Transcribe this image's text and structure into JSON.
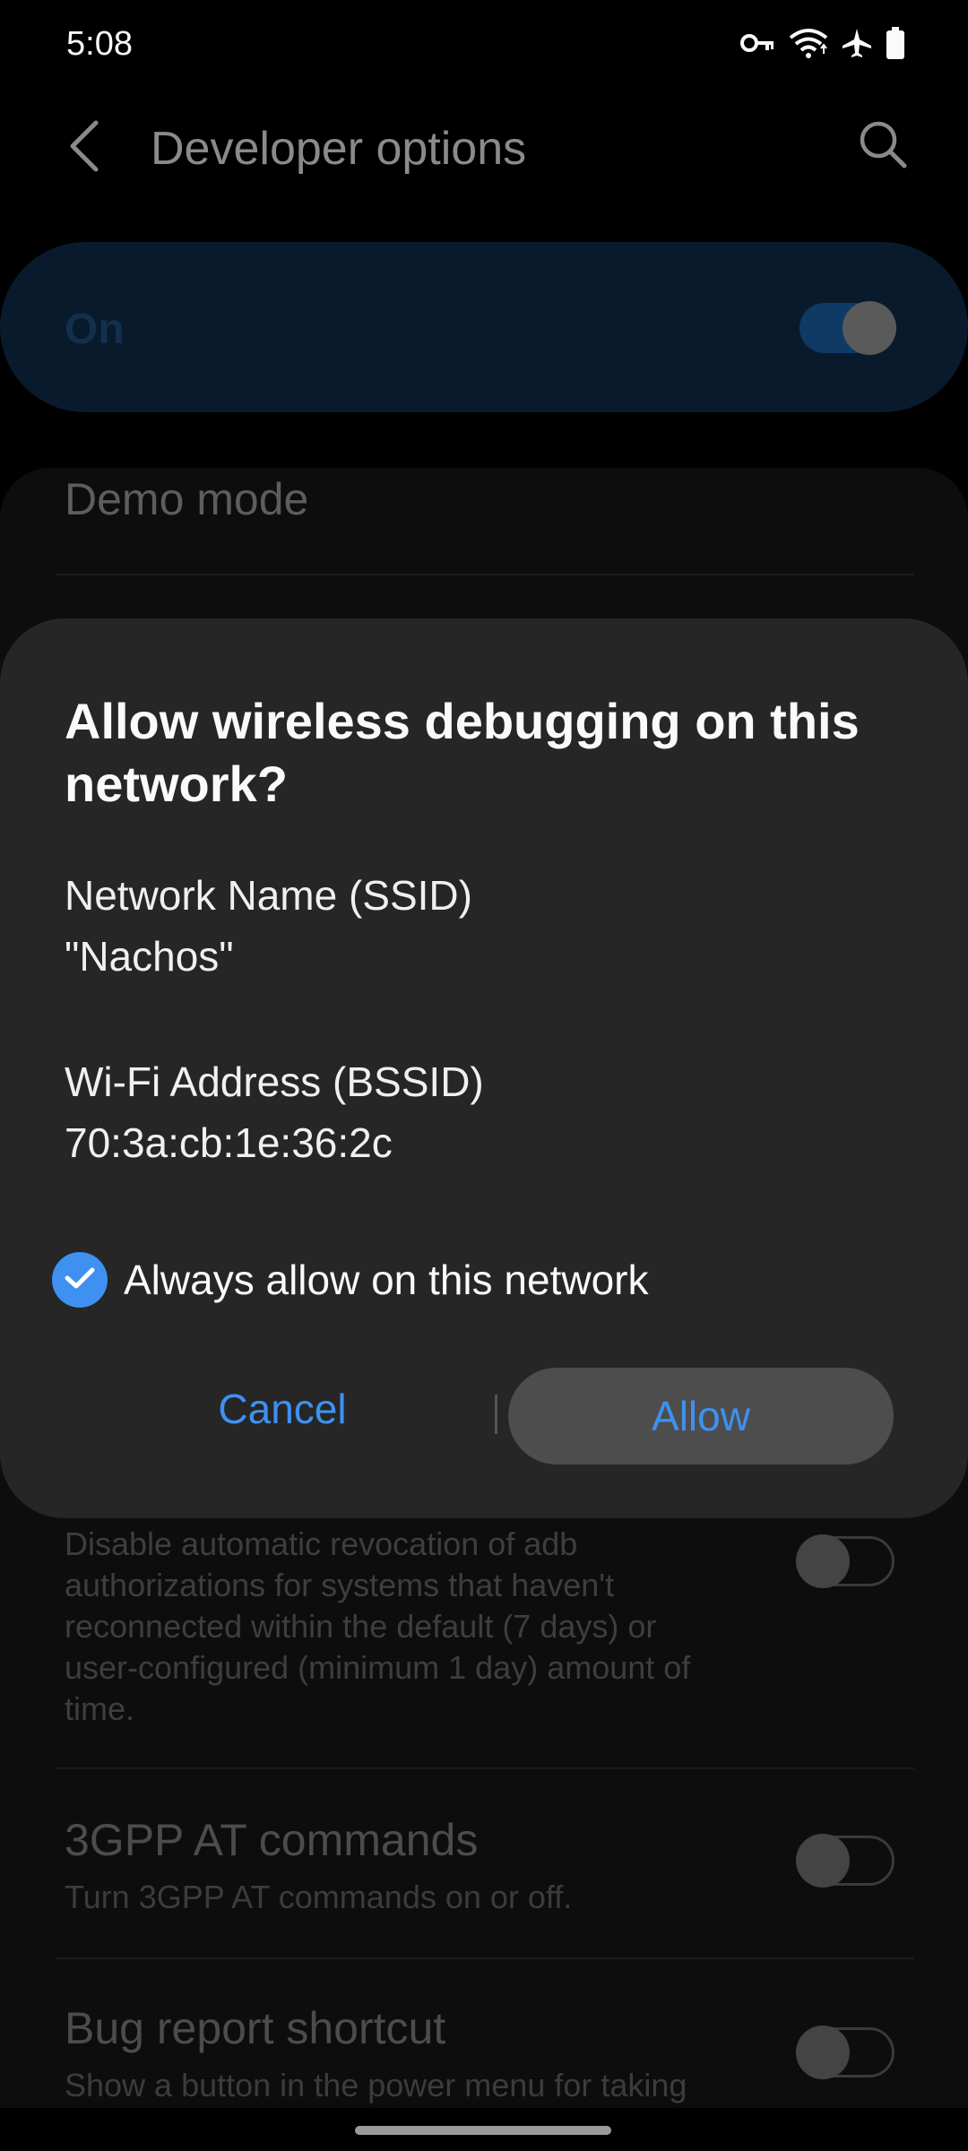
{
  "status_bar": {
    "time": "5:08",
    "icons": [
      "vpn-key-icon",
      "wifi-icon",
      "airplane-icon",
      "battery-icon"
    ]
  },
  "app_bar": {
    "title": "Developer options"
  },
  "master_switch": {
    "label": "On",
    "checked": true
  },
  "settings": {
    "demo_mode": "Demo mode",
    "revocation_desc": "Disable automatic revocation of adb authorizations for systems that haven't reconnected within the default (7 days) or user-configured (minimum 1 day) amount of time.",
    "items": [
      {
        "title": "3GPP AT commands",
        "subtitle": "Turn 3GPP AT commands on or off."
      },
      {
        "title": "Bug report shortcut",
        "subtitle": "Show a button in the power menu for taking"
      }
    ]
  },
  "dialog": {
    "title": "Allow wireless debugging on this network?",
    "ssid_label": "Network Name (SSID)",
    "ssid_value": "\"Nachos\"",
    "bssid_label": "Wi-Fi Address (BSSID)",
    "bssid_value": "70:3a:cb:1e:36:2c",
    "checkbox_label": "Always allow on this network",
    "checkbox_checked": true,
    "cancel_label": "Cancel",
    "allow_label": "Allow"
  },
  "colors": {
    "accent": "#3e91f0",
    "dialog_bg": "#262626",
    "background": "#000000"
  }
}
